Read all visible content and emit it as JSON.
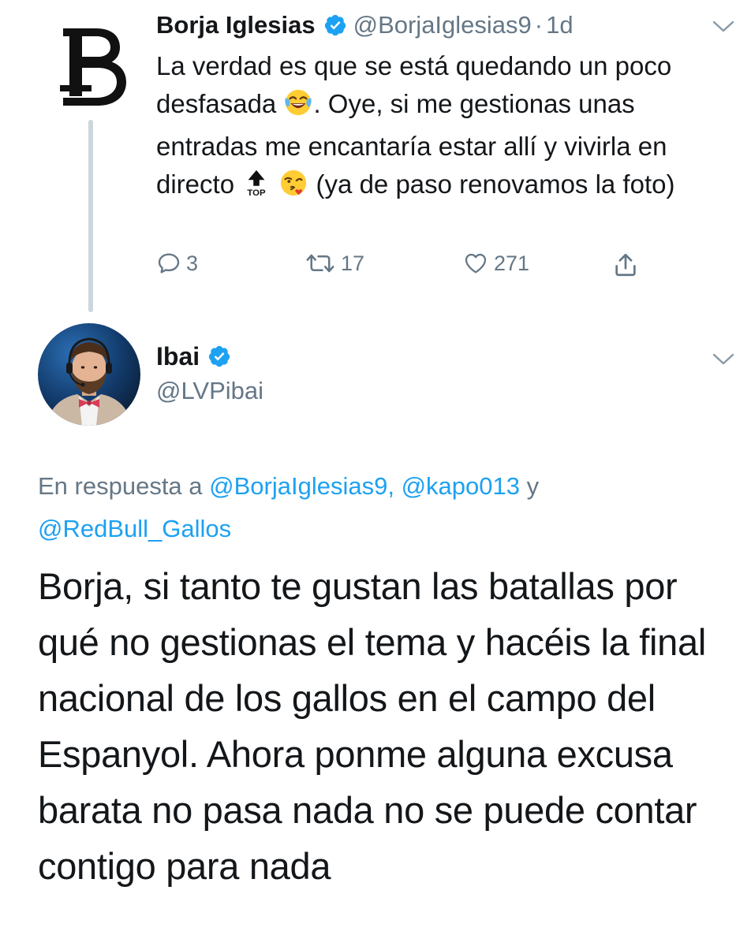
{
  "parent_tweet": {
    "author_name": "Borja Iglesias",
    "author_handle": "@BorjaIglesias9",
    "separator": "·",
    "time": "1d",
    "text_part1": "La verdad es que se está quedando un poco desfasada ",
    "emoji1": "tears-of-joy-emoji",
    "text_part2": ". Oye, si me gestionas unas entradas me encantaría estar allí y vivirla en directo ",
    "emoji2": "top-arrow-emoji",
    "emoji2_label": "TOP",
    "emoji3": "face-blowing-kiss-emoji",
    "text_part3": " (ya de paso renovamos la foto)",
    "replies": "3",
    "retweets": "17",
    "likes": "271"
  },
  "reply_tweet": {
    "author_name": "Ibai",
    "author_handle": "@LVPibai",
    "in_reply_prefix": "En respuesta a ",
    "mention1": "@BorjaIglesias9,",
    "mention2": "@kapo013",
    "conjunction": " y ",
    "mention3": "@RedBull_Gallos",
    "text": "Borja, si tanto te gustan las batallas por qué no gestionas el tema y hacéis la final nacional de los gallos en el campo del Espanyol. Ahora ponme alguna excusa barata no pasa nada no se puede contar contigo para nada"
  },
  "colors": {
    "text": "#14171a",
    "secondary": "#657786",
    "link": "#1da1f2",
    "verified": "#1da1f2",
    "thread_line": "#ccd6dd"
  }
}
